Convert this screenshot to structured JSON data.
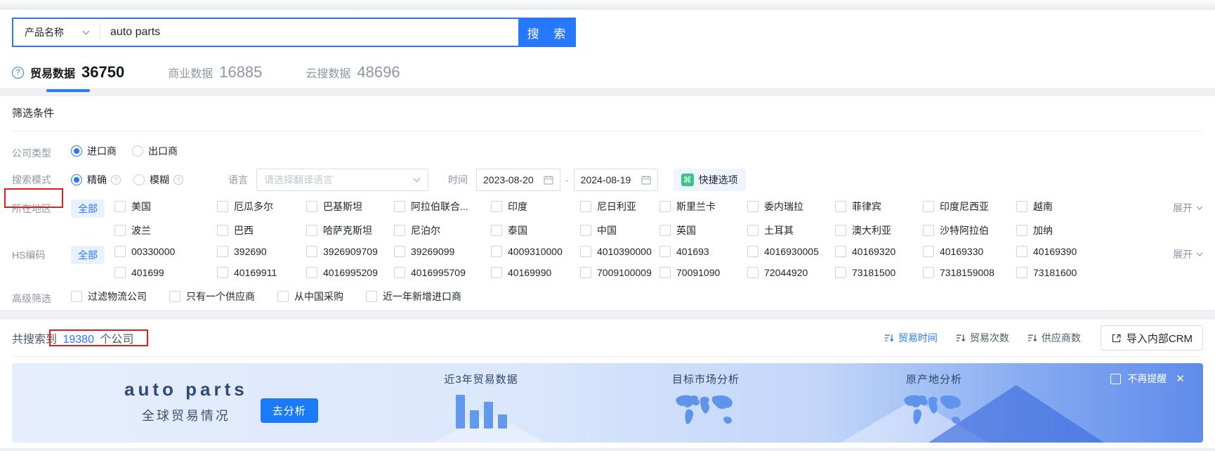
{
  "search": {
    "category": "产品名称",
    "query": "auto parts",
    "button_label": "搜 索"
  },
  "tabs": [
    {
      "label": "贸易数据",
      "count": "36750",
      "active": true
    },
    {
      "label": "商业数据",
      "count": "16885",
      "active": false
    },
    {
      "label": "云搜数据",
      "count": "48696",
      "active": false
    }
  ],
  "filters": {
    "title": "筛选条件",
    "company_type": {
      "label": "公司类型",
      "options": [
        {
          "label": "进口商",
          "selected": true
        },
        {
          "label": "出口商",
          "selected": false
        }
      ]
    },
    "search_mode": {
      "label": "搜索模式",
      "options": [
        {
          "label": "精确",
          "selected": true,
          "info": true
        },
        {
          "label": "模糊",
          "selected": false,
          "info": true
        }
      ]
    },
    "language": {
      "label": "语言",
      "placeholder": "请选择翻译语言"
    },
    "time": {
      "label": "时间",
      "start": "2023-08-20",
      "dash": "-",
      "end": "2024-08-19"
    },
    "shortcut_label": "快捷选项",
    "region": {
      "label": "所在地区",
      "all_label": "全部",
      "row1": [
        "美国",
        "厄瓜多尔",
        "巴基斯坦",
        "阿拉伯联合...",
        "印度",
        "尼日利亚",
        "斯里兰卡",
        "委内瑞拉",
        "菲律宾",
        "印度尼西亚",
        "越南"
      ],
      "row2": [
        "波兰",
        "巴西",
        "哈萨克斯坦",
        "尼泊尔",
        "泰国",
        "中国",
        "英国",
        "土耳其",
        "澳大利亚",
        "沙特阿拉伯",
        "加纳"
      ],
      "expand_label": "展开"
    },
    "hs_code": {
      "label": "HS编码",
      "all_label": "全部",
      "row1": [
        "00330000",
        "392690",
        "3926909709",
        "39269099",
        "4009310000",
        "4010390000",
        "401693",
        "4016930005",
        "40169320",
        "40169330",
        "40169390"
      ],
      "row2": [
        "401699",
        "40169911",
        "4016995209",
        "4016995709",
        "40169990",
        "7009100009",
        "70091090",
        "72044920",
        "73181500",
        "7318159008",
        "73181600"
      ],
      "expand_label": "展开"
    },
    "advanced": {
      "label": "高级筛选",
      "options": [
        "过滤物流公司",
        "只有一个供应商",
        "从中国采购",
        "近一年新增进口商"
      ]
    }
  },
  "results": {
    "summary_prefix": "共搜索到",
    "summary_count": "19380",
    "summary_suffix": "个公司",
    "sorts": [
      {
        "label": "贸易时间",
        "active": true
      },
      {
        "label": "贸易次数",
        "active": false
      },
      {
        "label": "供应商数",
        "active": false
      }
    ],
    "crm_button": "导入内部CRM"
  },
  "banner": {
    "title": "auto parts",
    "subtitle": "全球贸易情况",
    "analyze_button": "去分析",
    "cards": [
      {
        "title": "近3年贸易数据",
        "icon": "bar-chart-icon"
      },
      {
        "title": "目标市场分析",
        "icon": "world-map-icon"
      },
      {
        "title": "原产地分析",
        "icon": "world-map-icon"
      }
    ],
    "dismiss_label": "不再提醒"
  },
  "colors": {
    "primary": "#2878ff",
    "shortcut_green": "#3cc38a",
    "annotation_red": "#e31d1d",
    "banner_icon_blue": "#6298ee"
  }
}
